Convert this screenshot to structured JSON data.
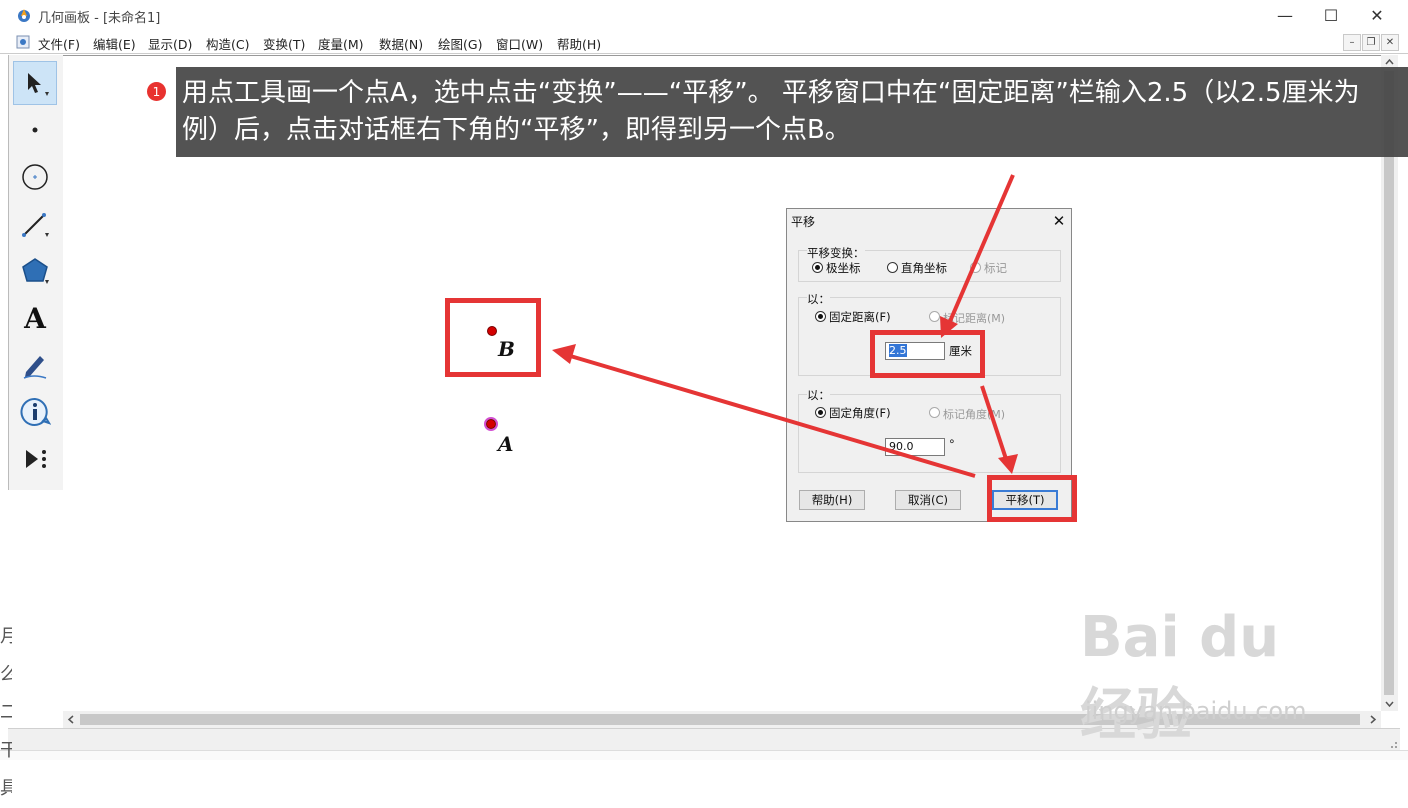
{
  "window": {
    "title": "几何画板 - [未命名1]",
    "minimize": "—",
    "maximize": "☐",
    "close": "✕"
  },
  "menu": {
    "items": [
      "文件(F)",
      "编辑(E)",
      "显示(D)",
      "构造(C)",
      "变换(T)",
      "度量(M)",
      "数据(N)",
      "绘图(G)",
      "窗口(W)",
      "帮助(H)"
    ],
    "mdi_minimize": "–",
    "mdi_restore": "❐",
    "mdi_close": "✕"
  },
  "toolbox": {
    "tools": [
      "arrow-select",
      "point",
      "compass",
      "straightedge",
      "polygon",
      "text",
      "marker",
      "information",
      "custom-tools"
    ],
    "text_tool_glyph": "A"
  },
  "instruction": {
    "step": "1",
    "text": "用点工具画一个点A，选中点击“变换”——“平移”。 平移窗口中在“固定距离”栏输入2.5（以2.5厘米为例）后，点击对话框右下角的“平移”，即得到另一个点B。"
  },
  "points": {
    "b_label": "B",
    "a_label": "A"
  },
  "dialog": {
    "title": "平移",
    "close": "✕",
    "transform_group_label": "平移变换：",
    "polar": "极坐标",
    "rect": "直角坐标",
    "marked": "标记",
    "by_label_1": "以：",
    "fixed_distance": "固定距离(F)",
    "marked_distance": "标记距离(M)",
    "distance_value": "2.5",
    "distance_unit": "厘米",
    "by_label_2": "以：",
    "fixed_angle": "固定角度(F)",
    "marked_angle": "标记角度(M)",
    "angle_value": "90.0",
    "angle_unit": "°",
    "help_button": "帮助(H)",
    "cancel_button": "取消(C)",
    "translate_button": "平移(T)"
  },
  "watermark": {
    "logo": "Bai du 经验",
    "url": "jingyan.baidu.com"
  },
  "colors": {
    "highlight_red": "#e53535",
    "banner_bg": "#464646",
    "point_red": "#d40000"
  },
  "edge_fragment": [
    "月",
    "么",
    "二",
    "干具"
  ]
}
